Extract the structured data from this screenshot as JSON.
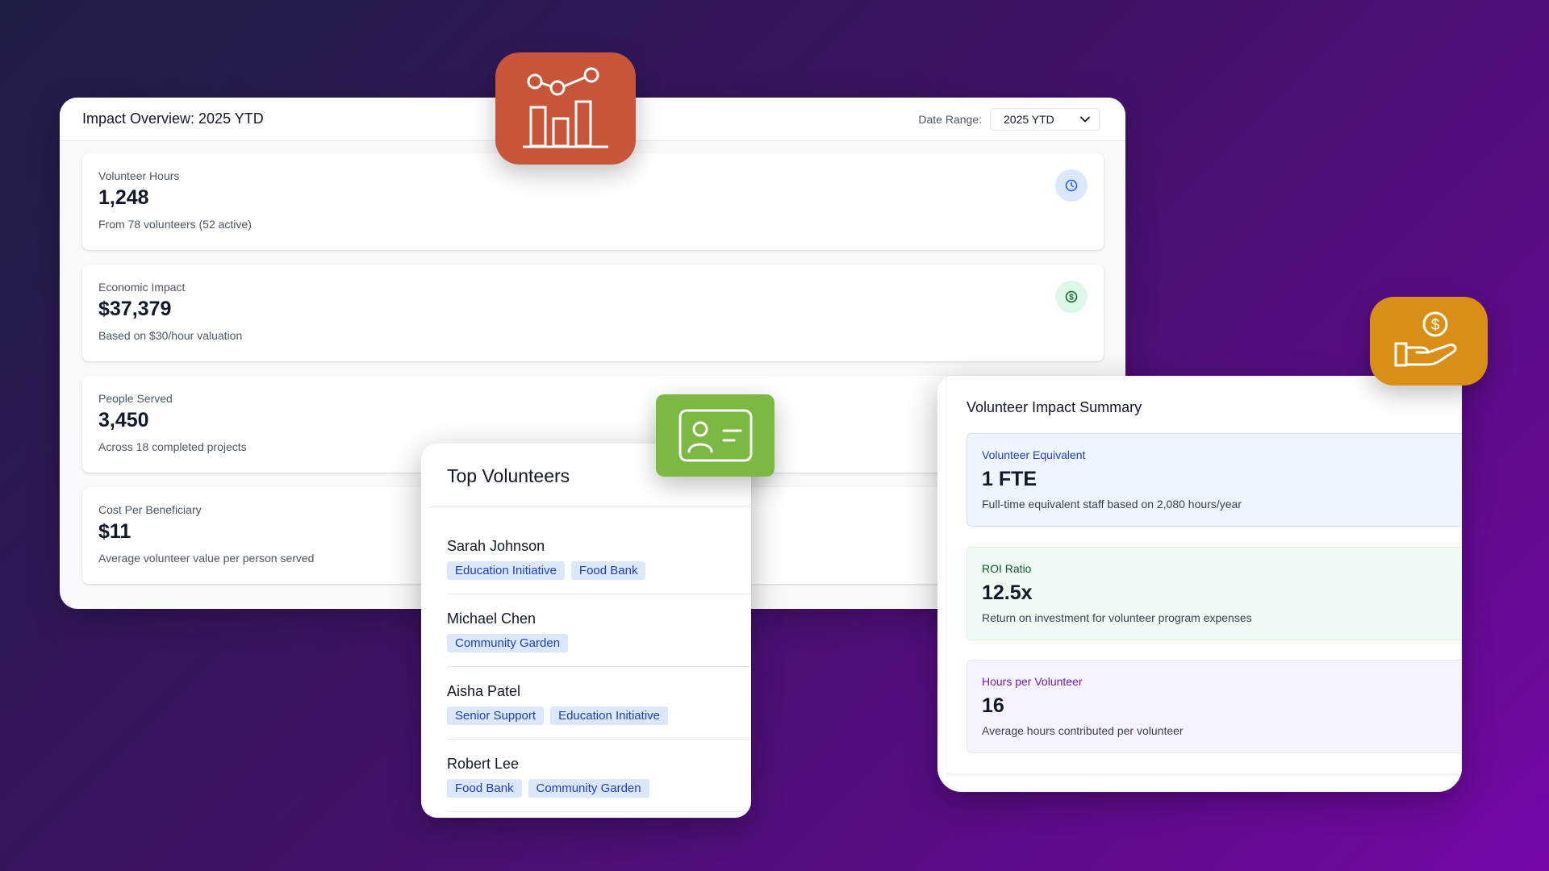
{
  "overview": {
    "title": "Impact Overview: 2025 YTD",
    "date_range_label": "Date Range:",
    "date_range_value": "2025 YTD",
    "metrics": [
      {
        "label": "Volunteer Hours",
        "value": "1,248",
        "sub": "From 78 volunteers (52 active)",
        "icon": "clock-icon"
      },
      {
        "label": "Economic Impact",
        "value": "$37,379",
        "sub": "Based on $30/hour valuation",
        "icon": "dollar-circle-icon"
      },
      {
        "label": "People Served",
        "value": "3,450",
        "sub": "Across 18 completed projects"
      },
      {
        "label": "Cost Per Beneficiary",
        "value": "$11",
        "sub": "Average volunteer value per person served"
      }
    ]
  },
  "volunteers": {
    "title": "Top Volunteers",
    "items": [
      {
        "name": "Sarah Johnson",
        "tags": [
          "Education Initiative",
          "Food Bank"
        ]
      },
      {
        "name": "Michael Chen",
        "tags": [
          "Community Garden"
        ]
      },
      {
        "name": "Aisha Patel",
        "tags": [
          "Senior Support",
          "Education Initiative"
        ]
      },
      {
        "name": "Robert Lee",
        "tags": [
          "Food Bank",
          "Community Garden"
        ]
      }
    ]
  },
  "summary": {
    "title": "Volunteer Impact Summary",
    "stats": [
      {
        "label": "Volunteer Equivalent",
        "value": "1 FTE",
        "sub": "Full-time equivalent staff based on 2,080 hours/year"
      },
      {
        "label": "ROI Ratio",
        "value": "12.5x",
        "sub": "Return on investment for volunteer program expenses"
      },
      {
        "label": "Hours per Volunteer",
        "value": "16",
        "sub": "Average hours contributed per volunteer"
      }
    ]
  },
  "app_icons": [
    "analytics-chart-icon",
    "id-card-icon",
    "hand-money-icon"
  ],
  "colors": {
    "chart_icon_bg": "#c6553a",
    "id_icon_bg": "#7cb944",
    "money_icon_bg": "#d98f16",
    "tag_bg": "#dbe8fb",
    "tag_text": "#1e40af"
  }
}
